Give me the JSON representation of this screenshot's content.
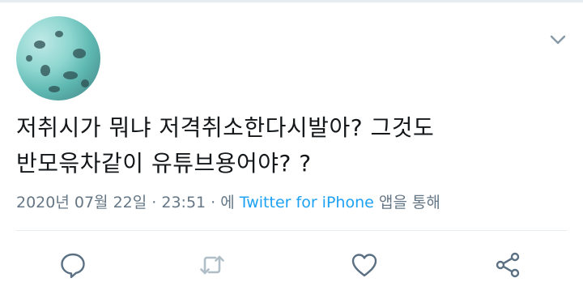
{
  "tweet": {
    "text_line1": "저취시가 뭐냐 저격취소한다시발아?  그것도",
    "text_line2": "반모윾차같이 유튜브용어야? ?",
    "date": "2020년 07월 22일",
    "separator": " · ",
    "time": "23:51",
    "via_prefix": "에 ",
    "client": "Twitter for iPhone",
    "via_suffix": " 앱을 통해"
  },
  "icons": {
    "menu": "chevron-down-icon",
    "reply": "reply-icon",
    "retweet": "retweet-icon",
    "like": "heart-icon",
    "share": "share-icon"
  },
  "colors": {
    "text": "#14171a",
    "muted": "#657786",
    "link": "#1da1f2",
    "icon": "#5b7083",
    "disabled_icon": "#b0bec8",
    "border": "#e6ecf0"
  }
}
